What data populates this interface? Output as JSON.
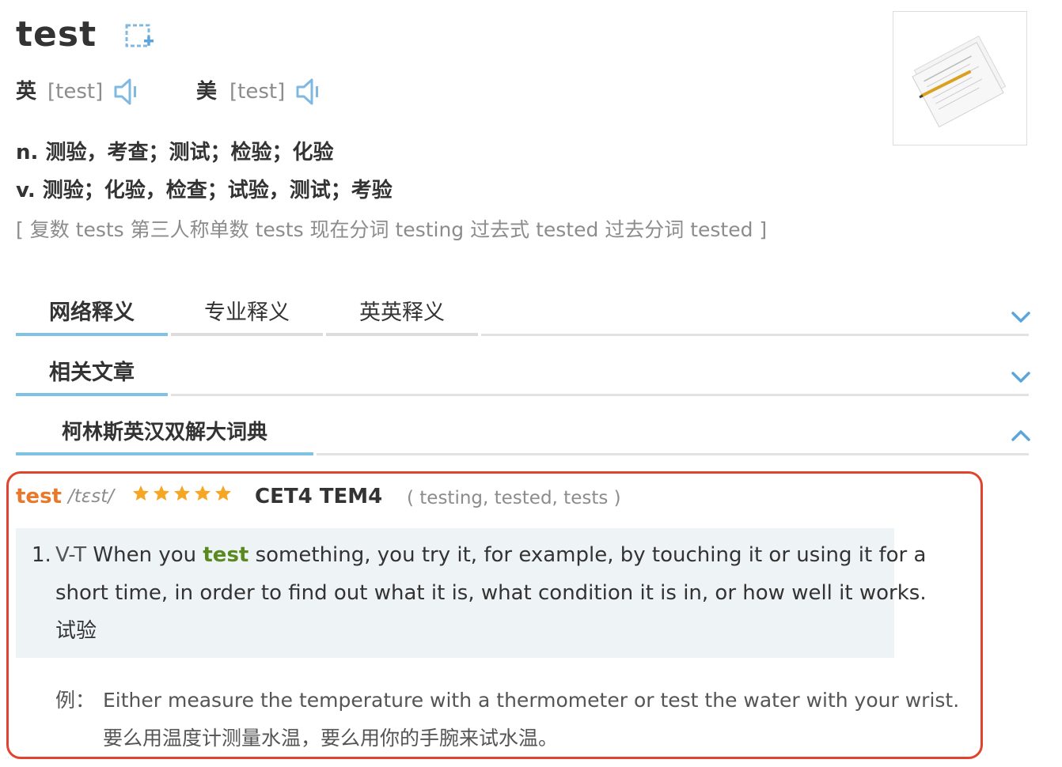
{
  "header": {
    "word": "test",
    "pronunciations": [
      {
        "label": "英",
        "phonetic": "[test]"
      },
      {
        "label": "美",
        "phonetic": "[test]"
      }
    ],
    "thumbnail_icon": "test-paper-pencil-image"
  },
  "definitions": [
    "n. 测验，考查；测试；检验；化验",
    "v. 测验；化验，检查；试验，测试；考验"
  ],
  "forms": "[ 复数 tests 第三人称单数 tests 现在分词 testing 过去式 tested 过去分词 tested ]",
  "tabs": {
    "row1": [
      "网络释义",
      "专业释义",
      "英英释义"
    ],
    "row2": "相关文章",
    "row3": "柯林斯英汉双解大词典"
  },
  "collins": {
    "word": "test",
    "phonetic": "/tɛst/",
    "stars": 5,
    "level": "CET4 TEM4",
    "inflections": "( testing, tested, tests )",
    "sense": {
      "num": "1.",
      "gram": "V-T",
      "text_before": " When you ",
      "headword": "test",
      "text_after": " something, you try it, for example, by touching it or using it for a",
      "line2": "short time, in order to find out what it is, what condition it is in, or how well it works.",
      "zh": "试验"
    },
    "example": {
      "label": "例：",
      "en": "Either measure the temperature with a thermometer or test the water with your wrist.",
      "zh": "要么用温度计测量水温，要么用你的手腕来试水温。"
    }
  },
  "colors": {
    "accent_blue": "#7fc2e6",
    "collins_word": "#e8792b",
    "highlight_green": "#5a8a1f",
    "box_red": "#e2432e",
    "star": "#f5a623"
  }
}
